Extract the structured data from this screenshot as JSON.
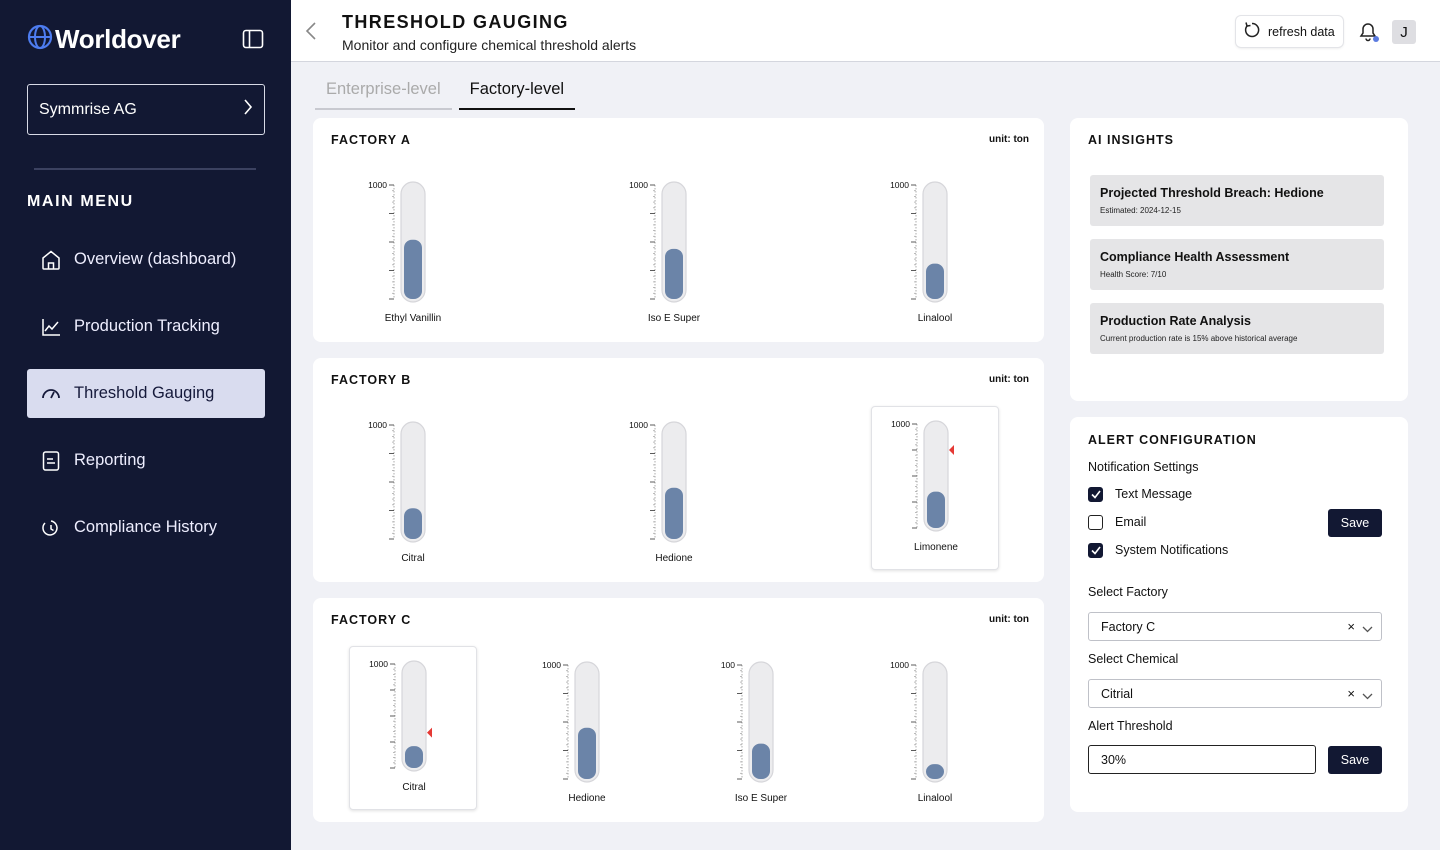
{
  "sidebar": {
    "brand": "Worldover",
    "organization": "Symmrise AG",
    "menu_title": "MAIN MENU",
    "items": [
      {
        "label": "Overview (dashboard)",
        "icon": "home-icon",
        "active": false
      },
      {
        "label": "Production Tracking",
        "icon": "line-chart-icon",
        "active": false
      },
      {
        "label": "Threshold Gauging",
        "icon": "gauge-icon",
        "active": true
      },
      {
        "label": "Reporting",
        "icon": "document-icon",
        "active": false
      },
      {
        "label": "Compliance History",
        "icon": "history-icon",
        "active": false
      }
    ]
  },
  "header": {
    "title": "THRESHOLD GAUGING",
    "subtitle": "Monitor and configure chemical threshold alerts",
    "refresh_label": "refresh data",
    "avatar_initial": "J"
  },
  "tabs": [
    {
      "label": "Enterprise-level",
      "active": false
    },
    {
      "label": "Factory-level",
      "active": true
    }
  ],
  "factories": [
    {
      "name": "FACTORY A",
      "unit": "unit: ton",
      "gauges": [
        {
          "chemical": "Ethyl Vanillin",
          "max_label": "1000",
          "fill_fraction": 0.52,
          "threshold_fraction": null,
          "selected": false
        },
        {
          "chemical": "Iso E Super",
          "max_label": "1000",
          "fill_fraction": 0.44,
          "threshold_fraction": null,
          "selected": false
        },
        {
          "chemical": "Linalool",
          "max_label": "1000",
          "fill_fraction": 0.31,
          "threshold_fraction": null,
          "selected": false
        }
      ]
    },
    {
      "name": "FACTORY B",
      "unit": "unit: ton",
      "gauges": [
        {
          "chemical": "Citral",
          "max_label": "1000",
          "fill_fraction": 0.27,
          "threshold_fraction": null,
          "selected": false
        },
        {
          "chemical": "Hedione",
          "max_label": "1000",
          "fill_fraction": 0.45,
          "threshold_fraction": null,
          "selected": false
        },
        {
          "chemical": "Limonene",
          "max_label": "1000",
          "fill_fraction": 0.35,
          "threshold_fraction": 0.75,
          "selected": true
        }
      ]
    },
    {
      "name": "FACTORY C",
      "unit": "unit: ton",
      "gauges": [
        {
          "chemical": "Citral",
          "max_label": "1000",
          "fill_fraction": 0.21,
          "threshold_fraction": 0.34,
          "selected": true
        },
        {
          "chemical": "Hedione",
          "max_label": "1000",
          "fill_fraction": 0.45,
          "threshold_fraction": null,
          "selected": false
        },
        {
          "chemical": "Iso E Super",
          "max_label": "100",
          "fill_fraction": 0.31,
          "threshold_fraction": null,
          "selected": false
        },
        {
          "chemical": "Linalool",
          "max_label": "1000",
          "fill_fraction": 0.13,
          "threshold_fraction": null,
          "selected": false
        }
      ]
    }
  ],
  "insights": {
    "title": "AI INSIGHTS",
    "items": [
      {
        "title": "Projected Threshold Breach: Hedione",
        "detail": "Estimated: 2024-12-15"
      },
      {
        "title": "Compliance Health Assessment",
        "detail": "Health Score: 7/10"
      },
      {
        "title": "Production Rate Analysis",
        "detail": "Current production rate is 15% above historical average"
      }
    ]
  },
  "alert_config": {
    "title": "ALERT CONFIGURATION",
    "notification_label": "Notification Settings",
    "options": [
      {
        "label": "Text Message",
        "checked": true
      },
      {
        "label": "Email",
        "checked": false
      },
      {
        "label": "System Notifications",
        "checked": true
      }
    ],
    "save_label": "Save",
    "factory_label": "Select Factory",
    "factory_value": "Factory C",
    "chemical_label": "Select Chemical",
    "chemical_value": "Citrial",
    "threshold_label": "Alert Threshold",
    "threshold_value": "30%",
    "clear_symbol": "×"
  },
  "colors": {
    "sidebar_bg": "#121833",
    "active_nav_bg": "#d9dcef",
    "gauge_fill": "#6b84a8",
    "threshold_marker": "#e53935",
    "accent_dot": "#5b7be0"
  }
}
